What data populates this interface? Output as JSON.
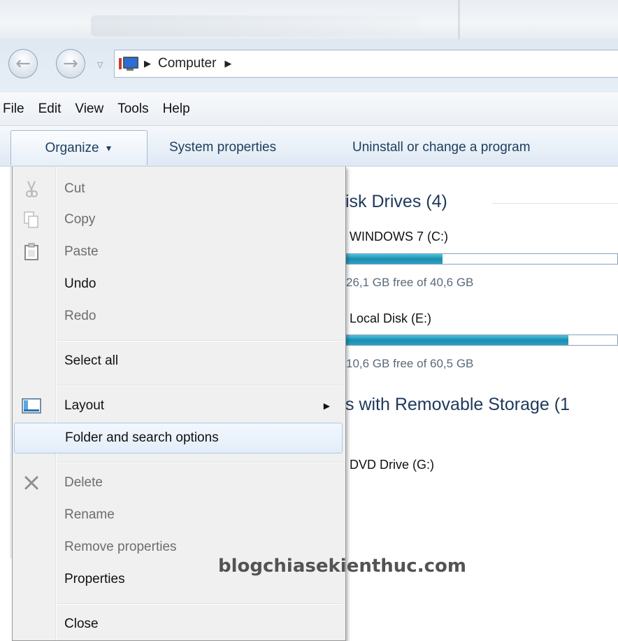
{
  "address": {
    "crumbs": [
      "Computer"
    ],
    "icon": "computer-icon"
  },
  "menubar": [
    "File",
    "Edit",
    "View",
    "Tools",
    "Help"
  ],
  "commandbar": {
    "organize": "Organize",
    "system_properties": "System properties",
    "uninstall": "Uninstall or change a program"
  },
  "content": {
    "hard_disk_header": "isk Drives (4)",
    "drives": [
      {
        "name": "WINDOWS 7 (C:)",
        "free": "26,1 GB free of 40,6 GB",
        "used_fraction": 0.36
      },
      {
        "name": "Local Disk (E:)",
        "free": "10,6 GB free of 60,5 GB",
        "used_fraction": 0.82
      }
    ],
    "removable_header": "s with Removable Storage (1",
    "dvd": "DVD Drive (G:)"
  },
  "organize_menu": {
    "cut": "Cut",
    "copy": "Copy",
    "paste": "Paste",
    "undo": "Undo",
    "redo": "Redo",
    "select_all": "Select all",
    "layout": "Layout",
    "folder_options": "Folder and search options",
    "delete": "Delete",
    "rename": "Rename",
    "remove_properties": "Remove properties",
    "properties": "Properties",
    "close": "Close"
  },
  "watermark": "blogchiasekienthuc.com"
}
